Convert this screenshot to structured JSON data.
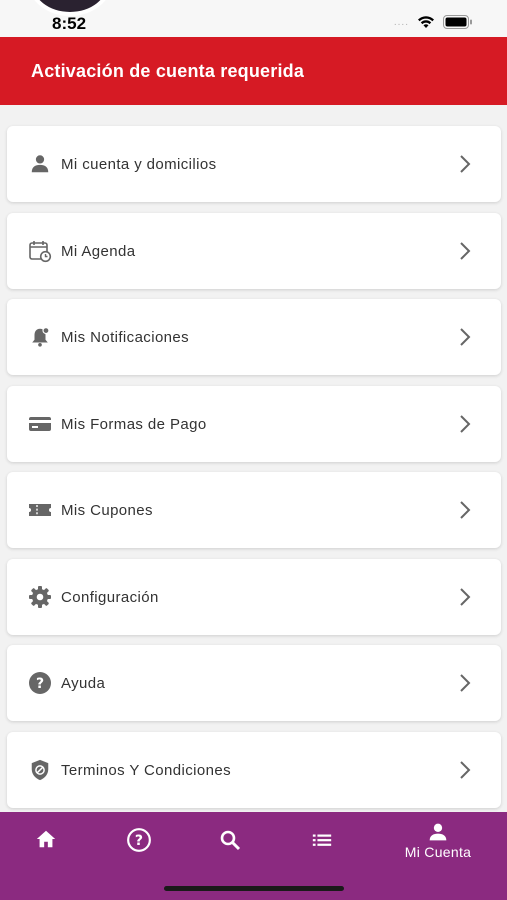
{
  "status": {
    "time": "8:52",
    "signal_dots": "...."
  },
  "header": {
    "title": "Activación de cuenta requerida",
    "color": "#d61a24"
  },
  "menu": {
    "items": [
      {
        "label": "Mi cuenta y domicilios",
        "icon": "person-icon"
      },
      {
        "label": "Mi Agenda",
        "icon": "calendar-clock-icon"
      },
      {
        "label": "Mis Notificaciones",
        "icon": "bell-icon"
      },
      {
        "label": "Mis Formas de Pago",
        "icon": "credit-card-icon"
      },
      {
        "label": "Mis Cupones",
        "icon": "ticket-icon"
      },
      {
        "label": "Configuración",
        "icon": "gear-icon"
      },
      {
        "label": "Ayuda",
        "icon": "help-circle-icon"
      },
      {
        "label": "Terminos Y Condiciones",
        "icon": "shield-icon"
      }
    ]
  },
  "bottom_nav": {
    "color": "#8b2a80",
    "items": [
      {
        "icon": "home-icon",
        "label": ""
      },
      {
        "icon": "help-icon",
        "label": ""
      },
      {
        "icon": "search-icon",
        "label": ""
      },
      {
        "icon": "list-icon",
        "label": ""
      },
      {
        "icon": "account-icon",
        "label": "Mi Cuenta"
      }
    ]
  }
}
